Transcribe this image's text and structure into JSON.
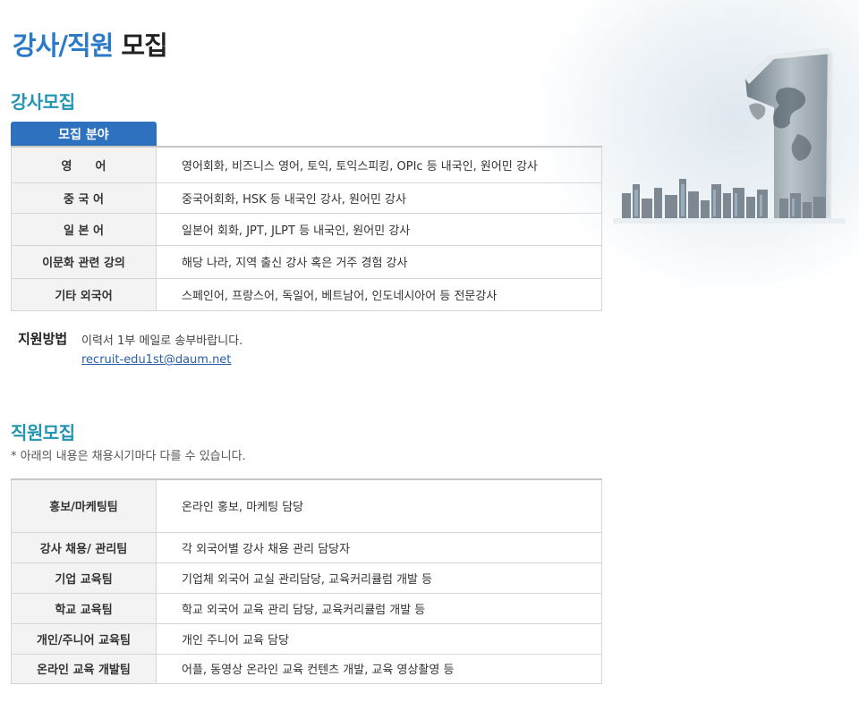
{
  "page": {
    "title_accent": "강사/직원",
    "title_rest": "모집"
  },
  "instructor": {
    "section_title": "강사모집",
    "tab_label": "모집 분야",
    "rows": [
      {
        "field": "영　　어",
        "detail": "영어회화, 비즈니스 영어, 토익, 토익스피킹, OPIc 등 내국인, 원어민 강사"
      },
      {
        "field": "중 국 어",
        "detail": "중국어회화, HSK 등 내국인 강사, 원어민 강사"
      },
      {
        "field": "일 본 어",
        "detail": "일본어 회화, JPT, JLPT 등 내국인, 원어민 강사"
      },
      {
        "field": "이문화 관련 강의",
        "detail": "해당 나라, 지역 출신 강사 혹은 거주 경험 강사"
      },
      {
        "field": "기타 외국어",
        "detail": "스페인어, 프랑스어, 독일어, 베트남어, 인도네시아어 등 전문강사"
      }
    ],
    "apply_label": "지원방법",
    "apply_text": "이력서 1부 메일로 송부바랍니다.",
    "apply_email": "recruit-edu1st@daum.net"
  },
  "staff": {
    "section_title": "직원모집",
    "note": "* 아래의 내용은 채용시기마다 다를 수 있습니다.",
    "rows": [
      {
        "team": "홍보/마케팅팀",
        "duty": "온라인 홍보, 마케팅 담당"
      },
      {
        "team": "강사 채용/ 관리팀",
        "duty": "각 외국어별 강사 채용 관리 담당자"
      },
      {
        "team": "기업 교육팀",
        "duty": "기업체 외국어 교실 관리담당, 교육커리큘럼 개발 등"
      },
      {
        "team": "학교 교육팀",
        "duty": "학교 외국어 교육 관리 담당, 교육커리큘럼 개발 등"
      },
      {
        "team": "개인/주니어 교육팀",
        "duty": "개인 주니어 교육 담당"
      },
      {
        "team": "온라인 교육 개발팀",
        "duty": "어플, 동영상 온라인 교육 컨텐츠 개발, 교육 영상촬영 등"
      }
    ]
  },
  "colors": {
    "accent_blue": "#2a7ac7",
    "section_teal": "#2495b0",
    "tab_blue": "#2e72bf",
    "link": "#2b5fa8"
  },
  "hero": {
    "icon": "number-one-building-icon"
  }
}
